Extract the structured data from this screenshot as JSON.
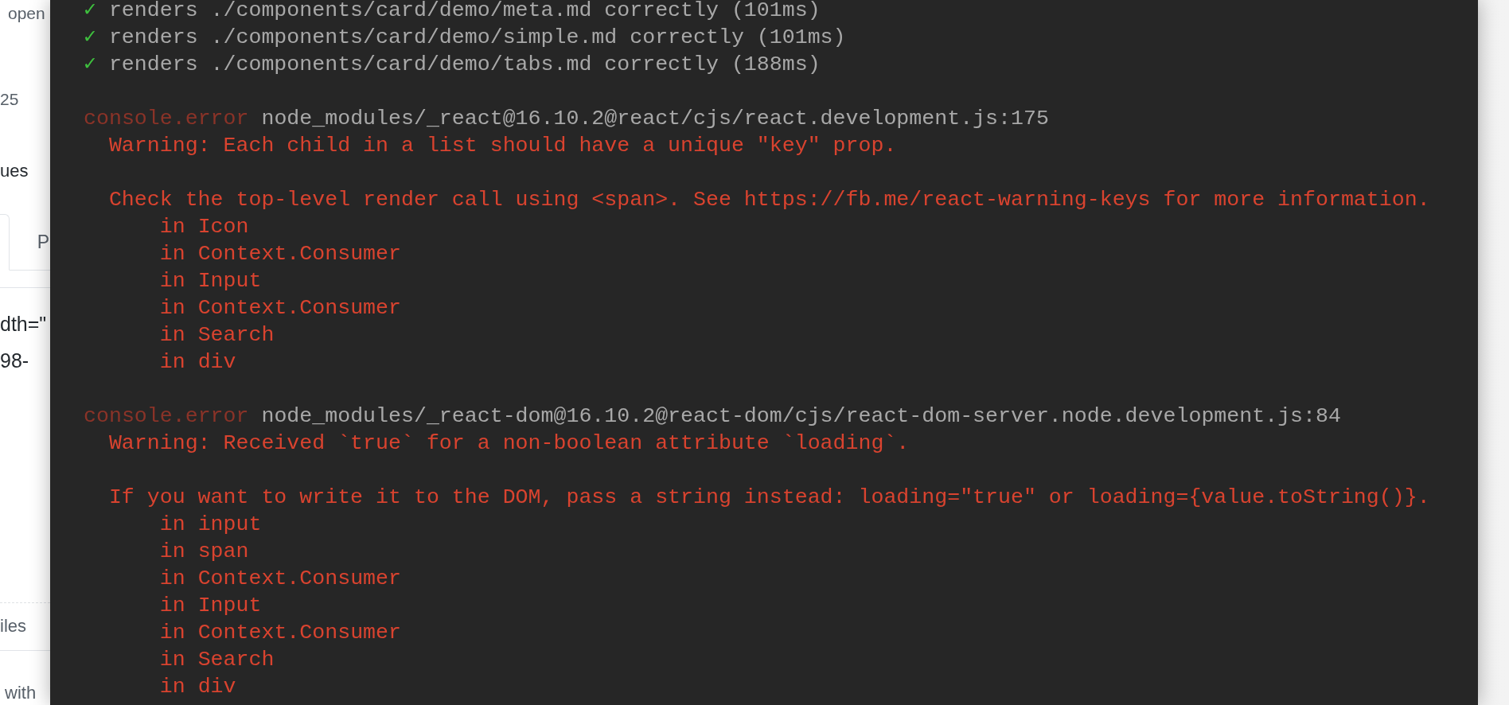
{
  "page": {
    "meta_top": "open",
    "meta": "25",
    "feedback": "ues",
    "tabs": [
      {
        "selected": true
      },
      {
        "label": "P",
        "selected": false
      }
    ],
    "lines": [
      "dth=\"",
      "98-"
    ],
    "attach_hint": "iles",
    "markdown_note": "with"
  },
  "terminal": {
    "lines": [
      {
        "kind": "pass",
        "mark": "✓",
        "text": "renders ./components/card/demo/meta.md correctly (101ms)"
      },
      {
        "kind": "pass",
        "mark": "✓",
        "text": "renders ./components/card/demo/simple.md correctly (101ms)"
      },
      {
        "kind": "pass",
        "mark": "✓",
        "text": "renders ./components/card/demo/tabs.md correctly (188ms)"
      },
      {
        "kind": "blank"
      },
      {
        "kind": "error",
        "label": "console.error",
        "text": "node_modules/_react@16.10.2@react/cjs/react.development.js:175"
      },
      {
        "kind": "message",
        "text": "Warning: Each child in a list should have a unique \"key\" prop."
      },
      {
        "kind": "blank"
      },
      {
        "kind": "message",
        "text": "Check the top-level render call using <span>. See https://fb.me/react-warning-keys for more information."
      },
      {
        "kind": "stack",
        "text": "in Icon"
      },
      {
        "kind": "stack",
        "text": "in Context.Consumer"
      },
      {
        "kind": "stack",
        "text": "in Input"
      },
      {
        "kind": "stack",
        "text": "in Context.Consumer"
      },
      {
        "kind": "stack",
        "text": "in Search"
      },
      {
        "kind": "stack",
        "text": "in div"
      },
      {
        "kind": "blank"
      },
      {
        "kind": "error",
        "label": "console.error",
        "text": "node_modules/_react-dom@16.10.2@react-dom/cjs/react-dom-server.node.development.js:84"
      },
      {
        "kind": "message",
        "text": "Warning: Received `true` for a non-boolean attribute `loading`."
      },
      {
        "kind": "blank"
      },
      {
        "kind": "message",
        "text": "If you want to write it to the DOM, pass a string instead: loading=\"true\" or loading={value.toString()}."
      },
      {
        "kind": "stack",
        "text": "in input"
      },
      {
        "kind": "stack",
        "text": "in span"
      },
      {
        "kind": "stack",
        "text": "in Context.Consumer"
      },
      {
        "kind": "stack",
        "text": "in Input"
      },
      {
        "kind": "stack",
        "text": "in Context.Consumer"
      },
      {
        "kind": "stack",
        "text": "in Search"
      },
      {
        "kind": "stack",
        "text": "in div"
      }
    ]
  }
}
